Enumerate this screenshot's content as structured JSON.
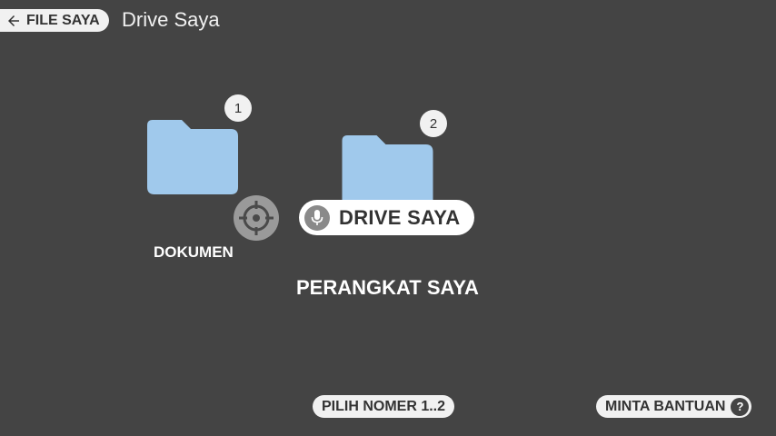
{
  "header": {
    "back_label": "FILE SAYA",
    "title": "Drive Saya"
  },
  "folders": [
    {
      "number": "1",
      "label": "DOKUMEN",
      "icon": "folder-icon"
    },
    {
      "number": "2",
      "label": "PERANGKAT SAYA",
      "icon": "folder-icon"
    }
  ],
  "voice": {
    "label": "DRIVE SAYA",
    "icon": "mic-icon"
  },
  "footer": {
    "pick_label": "PILIH NOMER 1..2",
    "help_label": "MINTA BANTUAN",
    "help_icon_glyph": "?"
  },
  "colors": {
    "background": "#444444",
    "folder": "#a0c9ec",
    "pill": "#f1f1f1",
    "crosshair": "#9a9a9a"
  }
}
